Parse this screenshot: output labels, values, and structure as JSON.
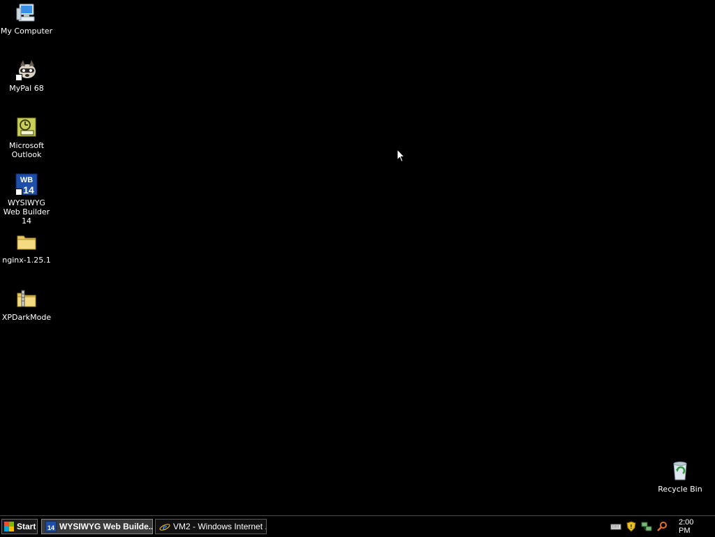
{
  "desktop": {
    "icons": [
      {
        "label": "My Computer",
        "icon": "computer-icon"
      },
      {
        "label": "MyPal 68",
        "icon": "raccoon-icon"
      },
      {
        "label": "Microsoft Outlook",
        "icon": "outlook-icon"
      },
      {
        "label": "WYSIWYG Web Builder 14",
        "icon": "web-builder-icon"
      },
      {
        "label": "nginx-1.25.1",
        "icon": "folder-icon"
      },
      {
        "label": "XPDarkMode",
        "icon": "zip-folder-icon"
      }
    ],
    "recycle_bin": {
      "label": "Recycle Bin",
      "icon": "recycle-bin-icon"
    }
  },
  "taskbar": {
    "start_label": "Start",
    "tasks": [
      {
        "label": "WYSIWYG Web Builde...",
        "icon": "web-builder-icon",
        "active": true
      },
      {
        "label": "VM2 - Windows Internet ...",
        "icon": "ie-icon",
        "active": false
      }
    ],
    "tray": {
      "icons": [
        "keyboard-icon",
        "security-shield-icon",
        "network-icon",
        "search-icon"
      ],
      "clock": "2:00 PM"
    }
  },
  "colors": {
    "desktop_bg": "#000000",
    "taskbar_bg": "#000000",
    "text": "#ffffff"
  }
}
